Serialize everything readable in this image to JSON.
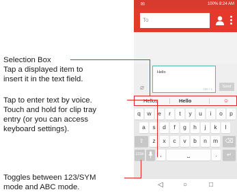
{
  "callouts": {
    "selection_box": {
      "title": "Selection Box",
      "body": [
        "Tap a displayed item to",
        "insert it in the text field."
      ]
    },
    "voice": {
      "body": [
        "Tap to enter text by voice.",
        "Touch and hold for clip tray",
        "entry (or you can access",
        "keyboard settings)."
      ]
    },
    "toggle": {
      "body": [
        "Toggles between 123/SYM",
        "mode and ABC mode."
      ]
    }
  },
  "phone": {
    "status_text": "100% 8:24 AM",
    "to_placeholder": "To",
    "compose_text": "Hello",
    "char_count": "155 / 1",
    "send_label": "Send",
    "suggestions": [
      "Hellos",
      "Hello"
    ],
    "keyboard": {
      "row1": [
        "q",
        "w",
        "e",
        "r",
        "t",
        "y",
        "u",
        "i",
        "o",
        "p"
      ],
      "row2": [
        "a",
        "s",
        "d",
        "f",
        "g",
        "h",
        "j",
        "k",
        "l"
      ],
      "row3": [
        "z",
        "x",
        "c",
        "v",
        "b",
        "n",
        "m"
      ],
      "sym_label": "123#",
      "comma": ",",
      "period": "."
    },
    "colors": {
      "accent": "#e4392b",
      "callout_line": "#e0252b",
      "field_border": "#4fb8b0"
    }
  }
}
